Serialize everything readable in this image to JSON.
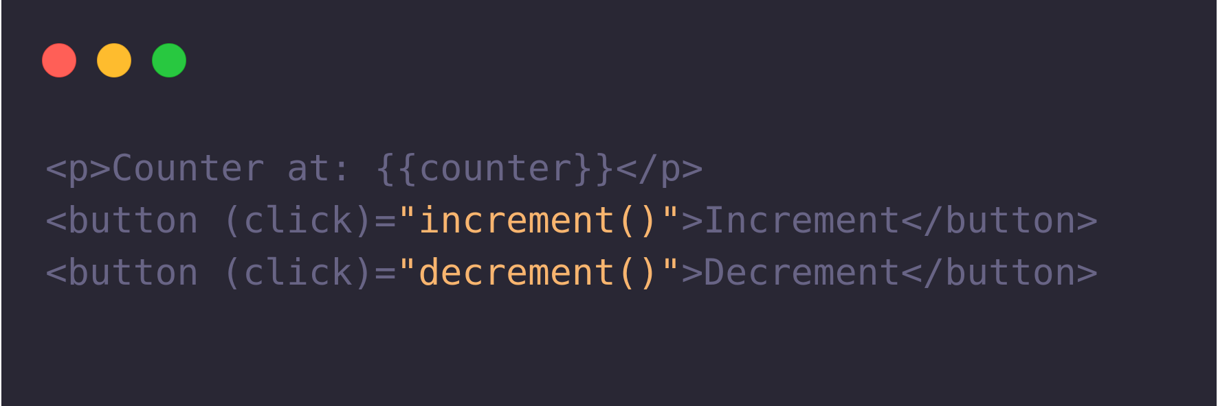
{
  "window": {
    "background": "#292734",
    "controls": [
      {
        "name": "close",
        "color": "#ff5f57",
        "border": "#e0443e"
      },
      {
        "name": "minimize",
        "color": "#febc2e",
        "border": "#dea123"
      },
      {
        "name": "zoom",
        "color": "#28c840",
        "border": "#1aab29"
      }
    ]
  },
  "colors": {
    "markup": "#686485",
    "string": "#f8b56f"
  },
  "code": {
    "line1": {
      "markup": "<p>Counter at: {{counter}}</p>"
    },
    "line2": {
      "before": "<button (click)=",
      "q1": "\"",
      "string": "increment()",
      "q2": "\"",
      "after": ">Increment</button>"
    },
    "line3": {
      "before": "<button (click)=",
      "q1": "\"",
      "string": "decrement()",
      "q2": "\"",
      "after": ">Decrement</button>"
    }
  }
}
